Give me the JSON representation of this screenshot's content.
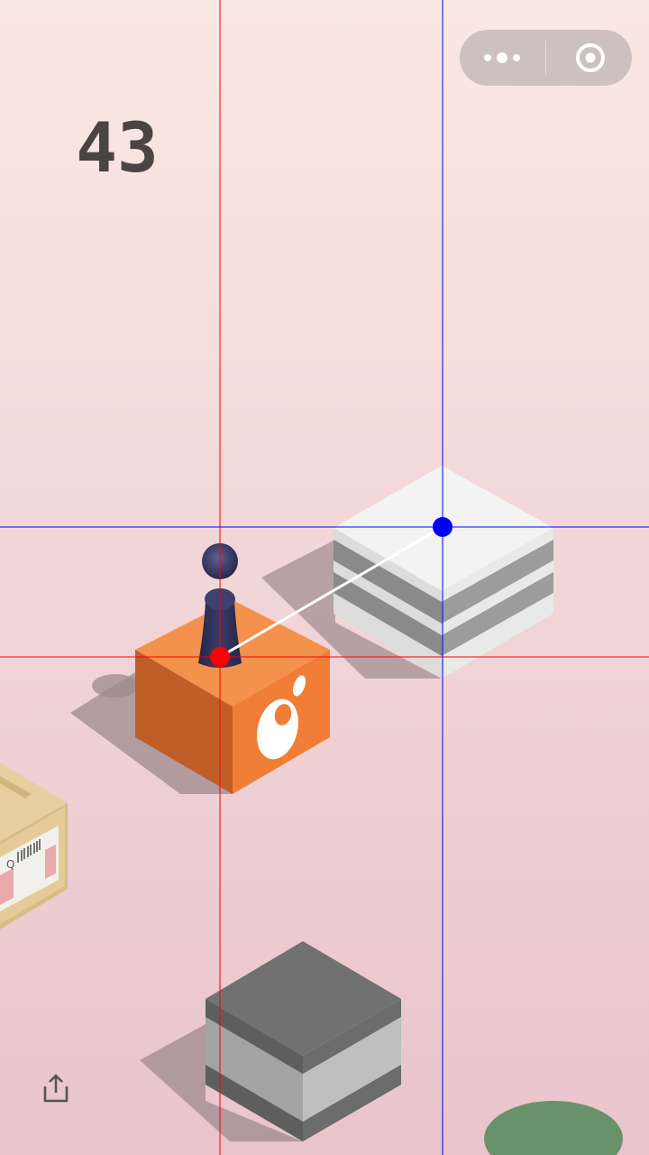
{
  "game": {
    "score": "43"
  },
  "menu": {
    "more_icon": "more-dots-icon",
    "close_icon": "target-circle-icon"
  },
  "share": {
    "icon": "share-upload-icon"
  },
  "label": {
    "letter": "Q"
  },
  "colors": {
    "background_top": "#FAE8E3",
    "background_bottom": "#E9C4CC",
    "orange_top": "#F4914D",
    "orange_left": "#C05E2A",
    "orange_right": "#F07E36",
    "player": "#2D2F4F",
    "guide_red": "#FF0000",
    "guide_blue": "#0000FF",
    "trajectory": "#FFFFFF"
  }
}
